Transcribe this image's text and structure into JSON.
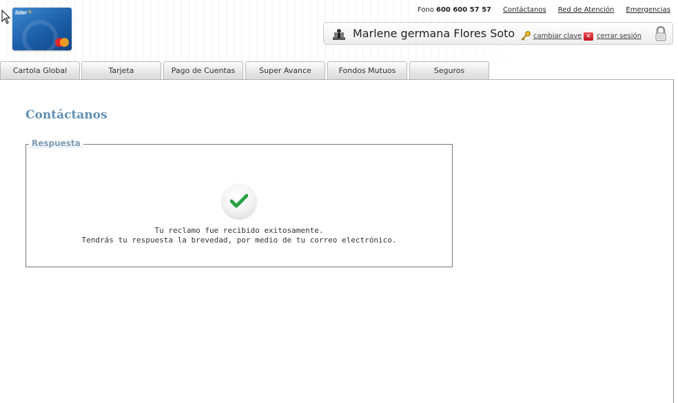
{
  "card": {
    "brand": "líder"
  },
  "header": {
    "phone_label": "Fono",
    "phone_number": "600 600 57 57",
    "links": [
      "Contáctanos",
      "Red de Atención",
      "Emergencias"
    ]
  },
  "user": {
    "name": "Marlene germana Flores Soto",
    "change_password": "cambiar clave",
    "logout": "cerrar sesión"
  },
  "tabs": [
    "Cartola Global",
    "Tarjeta",
    "Pago de Cuentas",
    "Super Avance",
    "Fondos Mutuos",
    "Seguros"
  ],
  "page": {
    "title": "Contáctanos",
    "legend": "Respuesta",
    "message_line1": "Tu reclamo fue recibido exitosamente.",
    "message_line2": "Tendrás tu respuesta la brevedad, por medio de tu correo electrónico."
  },
  "colors": {
    "title": "#6090b5",
    "success_check": "#2aa043",
    "logout_icon": "#d3222c"
  }
}
